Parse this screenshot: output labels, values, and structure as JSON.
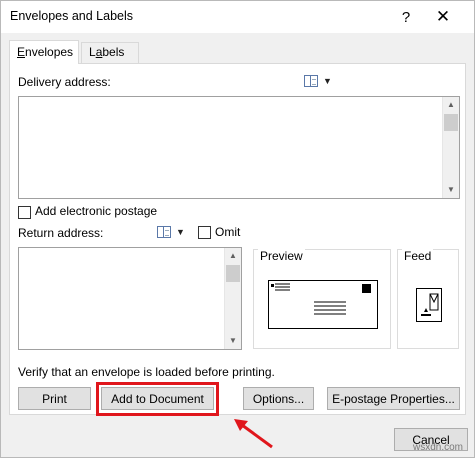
{
  "window": {
    "title": "Envelopes and Labels",
    "help_icon": "?",
    "close_icon": "✕"
  },
  "tabs": [
    {
      "label": "Envelopes",
      "accel": "E",
      "rest": "nvelopes"
    },
    {
      "label": "Labels",
      "accel": "a",
      "pre": "L",
      "rest": "bels"
    }
  ],
  "envelopes": {
    "delivery_label": "Delivery address:",
    "delivery_value": "",
    "electronic_postage_label": "Add electronic postage",
    "electronic_postage_checked": false,
    "return_label": "Return address:",
    "return_value": "",
    "omit_label": "Omit",
    "omit_checked": false,
    "preview_label": "Preview",
    "feed_label": "Feed",
    "verify_text": "Verify that an envelope is loaded before printing."
  },
  "buttons": {
    "print": "Print",
    "add_to_document": "Add to Document",
    "options": "Options...",
    "epostage": "E-postage Properties...",
    "cancel": "Cancel"
  },
  "watermark": "wsxdn.com",
  "colors": {
    "highlight": "#e0161c",
    "arrow": "#e0161c"
  }
}
